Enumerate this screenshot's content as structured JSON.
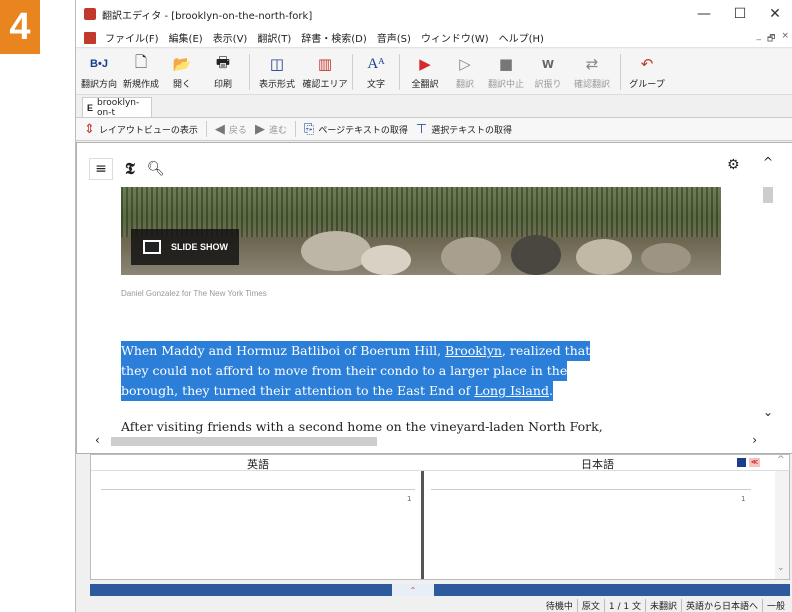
{
  "step_badge": "4",
  "window": {
    "title": "翻訳エディタ - [brooklyn-on-the-north-fork]",
    "controls": {
      "minimize": "—",
      "maximize": "☐",
      "close": "✕"
    }
  },
  "menu": {
    "items": [
      "ファイル(F)",
      "編集(E)",
      "表示(V)",
      "翻訳(T)",
      "辞書・検索(D)",
      "音声(S)",
      "ウィンドウ(W)",
      "ヘルプ(H)"
    ],
    "mdi_controls": [
      "_",
      "🗗",
      "×"
    ]
  },
  "toolbar": {
    "direction": "翻訳方向",
    "new": "新規作成",
    "open": "開く",
    "print": "印刷",
    "display_format": "表示形式",
    "confirm_area": "確認エリア",
    "text": "文字",
    "translate_all": "全翻訳",
    "translate": "翻訳",
    "stop": "翻訳中止",
    "alternatives": "訳振り",
    "confirm_translate": "確認翻訳",
    "group": "グループ",
    "direction_icon_text": "B•J"
  },
  "doc_tab": {
    "letter": "E",
    "label": "brooklyn-on-t"
  },
  "nav_toolbar": {
    "layout_view": "レイアウトビューの表示",
    "back": "戻る",
    "forward": "進む",
    "get_page_text": "ページテキストの取得",
    "get_selected_text": "選択テキストの取得"
  },
  "browser": {
    "logo": "𝕿",
    "slide_show": "SLIDE SHOW",
    "caption": "Daniel Gonzalez for The New York Times",
    "para1": {
      "line1_pre": "When Maddy and Hormuz Batliboi of Boerum Hill, ",
      "line1_link": "Brooklyn",
      "line1_post": ", realized that",
      "line2": "they could not afford to move from their condo to a larger place in the",
      "line3_pre": "borough, they turned their attention to the East End of ",
      "line3_link": "Long Island",
      "line3_post": "."
    },
    "para2": "After visiting friends with a second home on the vineyard-laden North Fork,"
  },
  "pane": {
    "source_lang": "英語",
    "target_lang": "日本語",
    "source_line_num": "1",
    "target_line_num": "1",
    "mini_b": "≪"
  },
  "status": {
    "state": "待機中",
    "mode": "原文",
    "sentence": "1 / 1 文",
    "translated": "未翻訳",
    "direction": "英語から日本語へ",
    "category": "一般"
  },
  "colors": {
    "badge": "#e8851e",
    "selection": "#2b7fd9",
    "status_blue": "#2d5a9c",
    "play_red": "#d62b2b"
  }
}
